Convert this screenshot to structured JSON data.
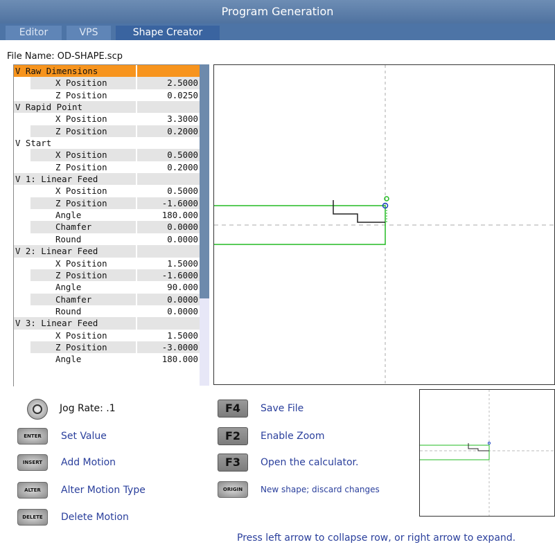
{
  "window": {
    "title": "Program Generation"
  },
  "tabs": [
    {
      "label": "Editor",
      "active": false
    },
    {
      "label": "VPS",
      "active": false
    },
    {
      "label": "Shape Creator",
      "active": true
    }
  ],
  "file": {
    "name": "File Name: OD-SHAPE.scp"
  },
  "tree": {
    "rows": [
      {
        "kind": "header",
        "label": "V Raw Dimensions",
        "value": "",
        "selected": true
      },
      {
        "kind": "field",
        "label": "X Position",
        "value": "2.5000"
      },
      {
        "kind": "field",
        "label": "Z Position",
        "value": "0.0250"
      },
      {
        "kind": "header",
        "label": "V Rapid Point",
        "value": ""
      },
      {
        "kind": "field",
        "label": "X Position",
        "value": "3.3000"
      },
      {
        "kind": "field",
        "label": "Z Position",
        "value": "0.2000"
      },
      {
        "kind": "header",
        "label": "V Start",
        "value": ""
      },
      {
        "kind": "field",
        "label": "X Position",
        "value": "0.5000"
      },
      {
        "kind": "field",
        "label": "Z Position",
        "value": "0.2000"
      },
      {
        "kind": "header",
        "label": "V 1: Linear Feed",
        "value": ""
      },
      {
        "kind": "field",
        "label": "X Position",
        "value": "0.5000"
      },
      {
        "kind": "field",
        "label": "Z Position",
        "value": "-1.6000"
      },
      {
        "kind": "field",
        "label": "Angle",
        "value": "180.000"
      },
      {
        "kind": "field",
        "label": "Chamfer",
        "value": "0.0000"
      },
      {
        "kind": "field",
        "label": "Round",
        "value": "0.0000"
      },
      {
        "kind": "header",
        "label": "V 2: Linear Feed",
        "value": ""
      },
      {
        "kind": "field",
        "label": "X Position",
        "value": "1.5000"
      },
      {
        "kind": "field",
        "label": "Z Position",
        "value": "-1.6000"
      },
      {
        "kind": "field",
        "label": "Angle",
        "value": "90.000"
      },
      {
        "kind": "field",
        "label": "Chamfer",
        "value": "0.0000"
      },
      {
        "kind": "field",
        "label": "Round",
        "value": "0.0000"
      },
      {
        "kind": "header",
        "label": "V 3: Linear Feed",
        "value": ""
      },
      {
        "kind": "field",
        "label": "X Position",
        "value": "1.5000"
      },
      {
        "kind": "field",
        "label": "Z Position",
        "value": "-3.0000"
      },
      {
        "kind": "field",
        "label": "Angle",
        "value": "180.000"
      }
    ]
  },
  "help": {
    "jog": {
      "icon": "jog-handle-icon",
      "text": "Jog Rate: .1"
    },
    "keys": [
      {
        "key": "ENTER",
        "text": "Set Value"
      },
      {
        "key": "INSERT",
        "text": "Add Motion"
      },
      {
        "key": "ALTER",
        "text": "Alter Motion Type"
      },
      {
        "key": "DELETE",
        "text": "Delete Motion"
      }
    ],
    "fkeys": [
      {
        "key": "F4",
        "text": "Save File"
      },
      {
        "key": "F2",
        "text": "Enable Zoom"
      },
      {
        "key": "F3",
        "text": "Open the calculator."
      },
      {
        "key": "ORIGIN",
        "text": "New shape; discard changes"
      }
    ]
  },
  "footer": {
    "text": "Press left arrow to collapse row, or right arrow to expand."
  },
  "colors": {
    "title_bar": "#5a7eab",
    "selected_row": "#f7941d",
    "stock_outline": "#22bb22",
    "tool_path": "#222222",
    "help_text": "#2a3f9c"
  }
}
